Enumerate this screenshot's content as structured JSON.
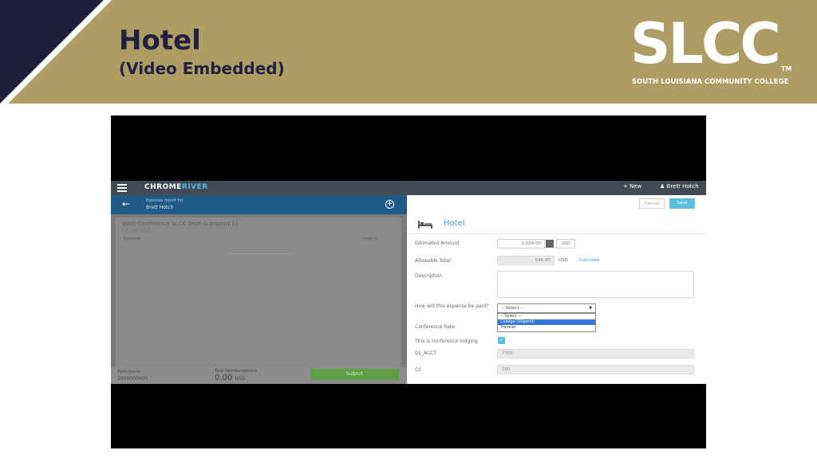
{
  "slide": {
    "title": "Hotel",
    "subtitle": "(Video Embedded)",
    "colors": {
      "banner": "#ad9c64",
      "navy": "#22203f",
      "text": "#22203f"
    }
  },
  "logo": {
    "word": "SLCC",
    "tm": "TM",
    "tagline": "SOUTH LOUISIANA COMMUNITY COLLEGE"
  },
  "app": {
    "brand_part1": "CHROME",
    "brand_part2": "RIVER",
    "new_label": "New",
    "user_name": "Brett Hotch",
    "left": {
      "header_line1": "Expense report for",
      "header_line2": "Brett Hotch",
      "card_title": "0000 Conference SLCC Dept (Lansport 1)",
      "card_sub": "0.0 | 000 USD",
      "col_left": "Expense",
      "col_right": "Lodging",
      "footer_label1": "Participants",
      "footer_value1": "2000000000",
      "footer_label2": "Total Reimbursement",
      "footer_amount": "0.00",
      "footer_currency": "USD",
      "submit_label": "Submit"
    },
    "form": {
      "cancel_label": "Cancel",
      "save_label": "Save",
      "heading": "Hotel",
      "estimated_amount_label": "Estimated Amount",
      "estimated_amount_value": "1,024.00",
      "estimated_currency": "USD",
      "allowable_total_label": "Allowable Total",
      "allowable_total_value": "546.40",
      "allowable_currency": "USD",
      "calculate_link": "Calculate",
      "description_label": "Description",
      "paid_question": "How will this expense be paid?",
      "paid_selected": "-- Select --",
      "paid_options": [
        "-- Select --",
        "College (Stipend)",
        "Traveler"
      ],
      "conference_rate_label": "Conference Rate",
      "conference_lodging_label": "This is conference lodging",
      "gl_acct_label": "GL_ACCT",
      "gl_acct_value": "7700",
      "cc_label": "CC",
      "cc_value": "100"
    }
  }
}
